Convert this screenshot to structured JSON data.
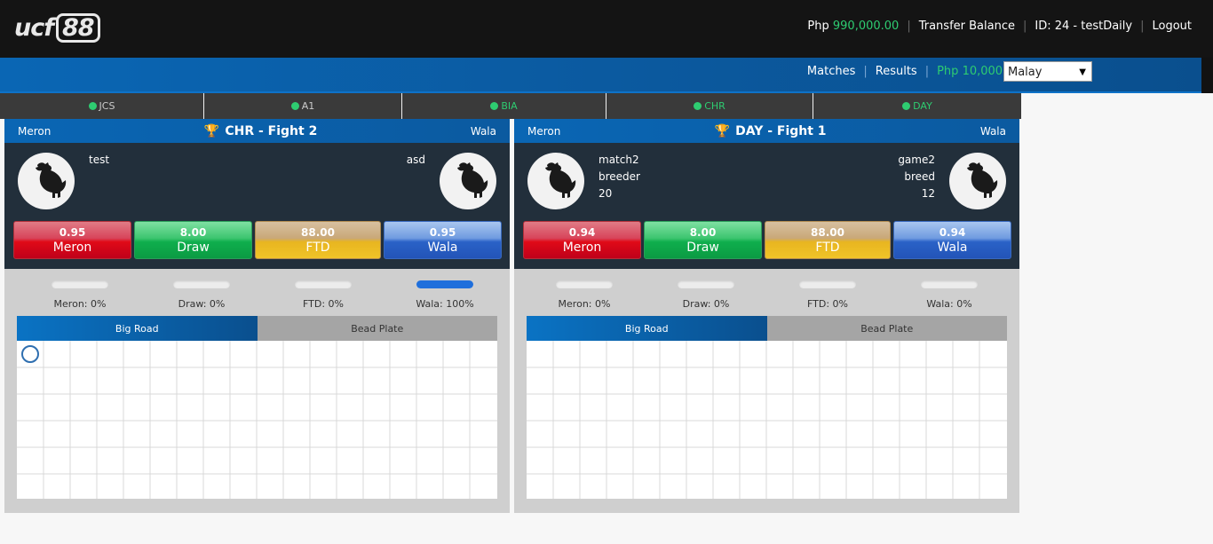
{
  "header": {
    "logo_text": "ucf",
    "logo_num": "88",
    "currency": "Php",
    "balance": "990,000.00",
    "transfer_label": "Transfer Balance",
    "id_label": "ID: 24 - testDaily",
    "logout_label": "Logout"
  },
  "subnav": {
    "matches_label": "Matches",
    "results_label": "Results",
    "wallet_currency": "Php",
    "wallet_balance": "10,000.00",
    "username": "testDaily",
    "language": "Malay"
  },
  "arena_tabs": [
    {
      "label": "JCS",
      "live": false
    },
    {
      "label": "A1",
      "live": false
    },
    {
      "label": "BIA",
      "live": true
    },
    {
      "label": "CHR",
      "live": true
    },
    {
      "label": "DAY",
      "live": true
    }
  ],
  "fights": [
    {
      "left_label": "Meron",
      "right_label": "Wala",
      "title": "CHR - Fight 2",
      "meron_player": {
        "name": "test",
        "breeder": "",
        "weight": ""
      },
      "wala_player": {
        "name": "asd",
        "breeder": "",
        "weight": ""
      },
      "bets": {
        "meron": {
          "odds": "0.95",
          "label": "Meron"
        },
        "draw": {
          "odds": "8.00",
          "label": "Draw"
        },
        "ftd": {
          "odds": "88.00",
          "label": "FTD"
        },
        "wala": {
          "odds": "0.95",
          "label": "Wala"
        }
      },
      "percentages": [
        {
          "label": "Meron: 0%",
          "value": 0
        },
        {
          "label": "Draw: 0%",
          "value": 0
        },
        {
          "label": "FTD: 0%",
          "value": 0
        },
        {
          "label": "Wala: 100%",
          "value": 100
        }
      ],
      "road_tabs": {
        "active": "Big Road",
        "inactive": "Bead Plate"
      },
      "road_marks": [
        {
          "col": 0,
          "row": 0,
          "result": "meron"
        }
      ]
    },
    {
      "left_label": "Meron",
      "right_label": "Wala",
      "title": "DAY - Fight 1",
      "meron_player": {
        "name": "match2",
        "breeder": "breeder",
        "weight": "20"
      },
      "wala_player": {
        "name": "game2",
        "breeder": "breed",
        "weight": "12"
      },
      "bets": {
        "meron": {
          "odds": "0.94",
          "label": "Meron"
        },
        "draw": {
          "odds": "8.00",
          "label": "Draw"
        },
        "ftd": {
          "odds": "88.00",
          "label": "FTD"
        },
        "wala": {
          "odds": "0.94",
          "label": "Wala"
        }
      },
      "percentages": [
        {
          "label": "Meron: 0%",
          "value": 0
        },
        {
          "label": "Draw: 0%",
          "value": 0
        },
        {
          "label": "FTD: 0%",
          "value": 0
        },
        {
          "label": "Wala: 0%",
          "value": 0
        }
      ],
      "road_tabs": {
        "active": "Big Road",
        "inactive": "Bead Plate"
      },
      "road_marks": []
    }
  ],
  "colors": {
    "accent_blue": "#0a66b4",
    "balance_green": "#2ecc71",
    "meron_red": "#e00a17",
    "draw_green": "#0fae4d",
    "ftd_gold": "#e8b520",
    "wala_blue": "#2a62c7",
    "road_mark_blue": "#2f6fb0"
  }
}
